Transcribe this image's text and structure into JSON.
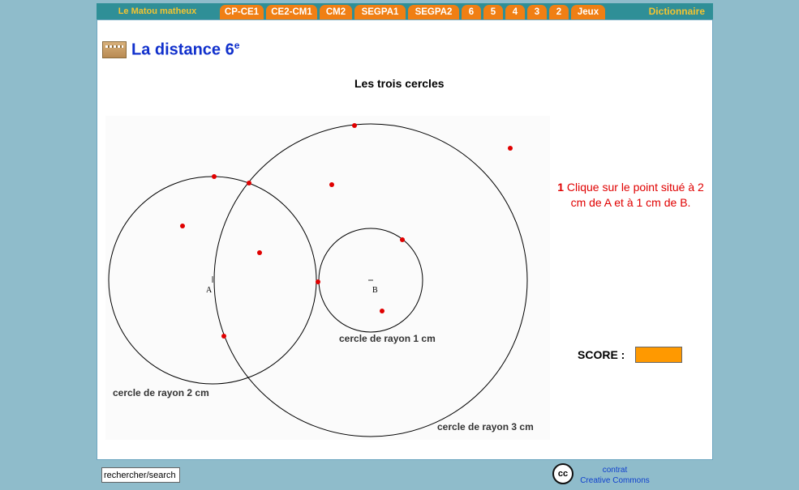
{
  "nav": {
    "brand": "Le Matou matheux",
    "tabs": [
      "CP-CE1",
      "CE2-CM1",
      "CM2",
      "SEGPA1",
      "SEGPA2",
      "6",
      "5",
      "4",
      "3",
      "2",
      "Jeux"
    ],
    "dictionary": "Dictionnaire",
    "colors": {
      "bar": "#2f8f97",
      "tab": "#f07f14",
      "brand": "#f4c430"
    }
  },
  "page": {
    "title": "La distance 6",
    "title_sup": "e",
    "exercise_title": "Les trois cercles"
  },
  "figure": {
    "point_a": "A",
    "point_b": "B",
    "labels": {
      "circle_a": "cercle de rayon 2 cm",
      "circle_b": "cercle de rayon 1 cm",
      "circle_c": "cercle de rayon 3 cm"
    },
    "point_color": "#e00000"
  },
  "instruction": {
    "number": "1",
    "text": " Clique sur le point situé à 2 cm de A et à 1 cm de B."
  },
  "score": {
    "label": "SCORE :",
    "value": ""
  },
  "footer": {
    "search_value": "rechercher/search",
    "cc_icon": "cc-icon",
    "cc_line1": "contrat",
    "cc_line2": "Creative Commons"
  }
}
